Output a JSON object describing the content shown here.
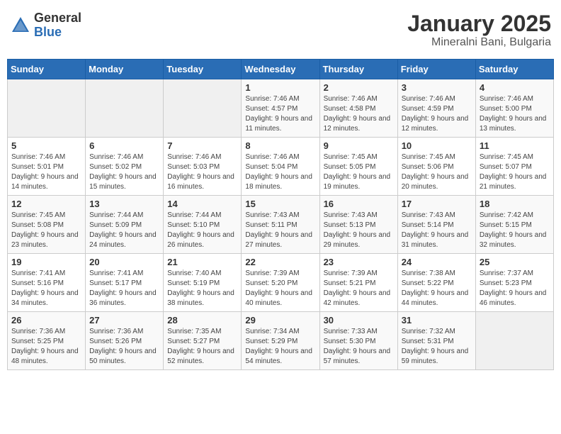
{
  "header": {
    "logo_general": "General",
    "logo_blue": "Blue",
    "month_title": "January 2025",
    "location": "Mineralni Bani, Bulgaria"
  },
  "weekdays": [
    "Sunday",
    "Monday",
    "Tuesday",
    "Wednesday",
    "Thursday",
    "Friday",
    "Saturday"
  ],
  "weeks": [
    [
      {
        "day": "",
        "sunrise": "",
        "sunset": "",
        "daylight": ""
      },
      {
        "day": "",
        "sunrise": "",
        "sunset": "",
        "daylight": ""
      },
      {
        "day": "",
        "sunrise": "",
        "sunset": "",
        "daylight": ""
      },
      {
        "day": "1",
        "sunrise": "Sunrise: 7:46 AM",
        "sunset": "Sunset: 4:57 PM",
        "daylight": "Daylight: 9 hours and 11 minutes."
      },
      {
        "day": "2",
        "sunrise": "Sunrise: 7:46 AM",
        "sunset": "Sunset: 4:58 PM",
        "daylight": "Daylight: 9 hours and 12 minutes."
      },
      {
        "day": "3",
        "sunrise": "Sunrise: 7:46 AM",
        "sunset": "Sunset: 4:59 PM",
        "daylight": "Daylight: 9 hours and 12 minutes."
      },
      {
        "day": "4",
        "sunrise": "Sunrise: 7:46 AM",
        "sunset": "Sunset: 5:00 PM",
        "daylight": "Daylight: 9 hours and 13 minutes."
      }
    ],
    [
      {
        "day": "5",
        "sunrise": "Sunrise: 7:46 AM",
        "sunset": "Sunset: 5:01 PM",
        "daylight": "Daylight: 9 hours and 14 minutes."
      },
      {
        "day": "6",
        "sunrise": "Sunrise: 7:46 AM",
        "sunset": "Sunset: 5:02 PM",
        "daylight": "Daylight: 9 hours and 15 minutes."
      },
      {
        "day": "7",
        "sunrise": "Sunrise: 7:46 AM",
        "sunset": "Sunset: 5:03 PM",
        "daylight": "Daylight: 9 hours and 16 minutes."
      },
      {
        "day": "8",
        "sunrise": "Sunrise: 7:46 AM",
        "sunset": "Sunset: 5:04 PM",
        "daylight": "Daylight: 9 hours and 18 minutes."
      },
      {
        "day": "9",
        "sunrise": "Sunrise: 7:45 AM",
        "sunset": "Sunset: 5:05 PM",
        "daylight": "Daylight: 9 hours and 19 minutes."
      },
      {
        "day": "10",
        "sunrise": "Sunrise: 7:45 AM",
        "sunset": "Sunset: 5:06 PM",
        "daylight": "Daylight: 9 hours and 20 minutes."
      },
      {
        "day": "11",
        "sunrise": "Sunrise: 7:45 AM",
        "sunset": "Sunset: 5:07 PM",
        "daylight": "Daylight: 9 hours and 21 minutes."
      }
    ],
    [
      {
        "day": "12",
        "sunrise": "Sunrise: 7:45 AM",
        "sunset": "Sunset: 5:08 PM",
        "daylight": "Daylight: 9 hours and 23 minutes."
      },
      {
        "day": "13",
        "sunrise": "Sunrise: 7:44 AM",
        "sunset": "Sunset: 5:09 PM",
        "daylight": "Daylight: 9 hours and 24 minutes."
      },
      {
        "day": "14",
        "sunrise": "Sunrise: 7:44 AM",
        "sunset": "Sunset: 5:10 PM",
        "daylight": "Daylight: 9 hours and 26 minutes."
      },
      {
        "day": "15",
        "sunrise": "Sunrise: 7:43 AM",
        "sunset": "Sunset: 5:11 PM",
        "daylight": "Daylight: 9 hours and 27 minutes."
      },
      {
        "day": "16",
        "sunrise": "Sunrise: 7:43 AM",
        "sunset": "Sunset: 5:13 PM",
        "daylight": "Daylight: 9 hours and 29 minutes."
      },
      {
        "day": "17",
        "sunrise": "Sunrise: 7:43 AM",
        "sunset": "Sunset: 5:14 PM",
        "daylight": "Daylight: 9 hours and 31 minutes."
      },
      {
        "day": "18",
        "sunrise": "Sunrise: 7:42 AM",
        "sunset": "Sunset: 5:15 PM",
        "daylight": "Daylight: 9 hours and 32 minutes."
      }
    ],
    [
      {
        "day": "19",
        "sunrise": "Sunrise: 7:41 AM",
        "sunset": "Sunset: 5:16 PM",
        "daylight": "Daylight: 9 hours and 34 minutes."
      },
      {
        "day": "20",
        "sunrise": "Sunrise: 7:41 AM",
        "sunset": "Sunset: 5:17 PM",
        "daylight": "Daylight: 9 hours and 36 minutes."
      },
      {
        "day": "21",
        "sunrise": "Sunrise: 7:40 AM",
        "sunset": "Sunset: 5:19 PM",
        "daylight": "Daylight: 9 hours and 38 minutes."
      },
      {
        "day": "22",
        "sunrise": "Sunrise: 7:39 AM",
        "sunset": "Sunset: 5:20 PM",
        "daylight": "Daylight: 9 hours and 40 minutes."
      },
      {
        "day": "23",
        "sunrise": "Sunrise: 7:39 AM",
        "sunset": "Sunset: 5:21 PM",
        "daylight": "Daylight: 9 hours and 42 minutes."
      },
      {
        "day": "24",
        "sunrise": "Sunrise: 7:38 AM",
        "sunset": "Sunset: 5:22 PM",
        "daylight": "Daylight: 9 hours and 44 minutes."
      },
      {
        "day": "25",
        "sunrise": "Sunrise: 7:37 AM",
        "sunset": "Sunset: 5:23 PM",
        "daylight": "Daylight: 9 hours and 46 minutes."
      }
    ],
    [
      {
        "day": "26",
        "sunrise": "Sunrise: 7:36 AM",
        "sunset": "Sunset: 5:25 PM",
        "daylight": "Daylight: 9 hours and 48 minutes."
      },
      {
        "day": "27",
        "sunrise": "Sunrise: 7:36 AM",
        "sunset": "Sunset: 5:26 PM",
        "daylight": "Daylight: 9 hours and 50 minutes."
      },
      {
        "day": "28",
        "sunrise": "Sunrise: 7:35 AM",
        "sunset": "Sunset: 5:27 PM",
        "daylight": "Daylight: 9 hours and 52 minutes."
      },
      {
        "day": "29",
        "sunrise": "Sunrise: 7:34 AM",
        "sunset": "Sunset: 5:29 PM",
        "daylight": "Daylight: 9 hours and 54 minutes."
      },
      {
        "day": "30",
        "sunrise": "Sunrise: 7:33 AM",
        "sunset": "Sunset: 5:30 PM",
        "daylight": "Daylight: 9 hours and 57 minutes."
      },
      {
        "day": "31",
        "sunrise": "Sunrise: 7:32 AM",
        "sunset": "Sunset: 5:31 PM",
        "daylight": "Daylight: 9 hours and 59 minutes."
      },
      {
        "day": "",
        "sunrise": "",
        "sunset": "",
        "daylight": ""
      }
    ]
  ]
}
